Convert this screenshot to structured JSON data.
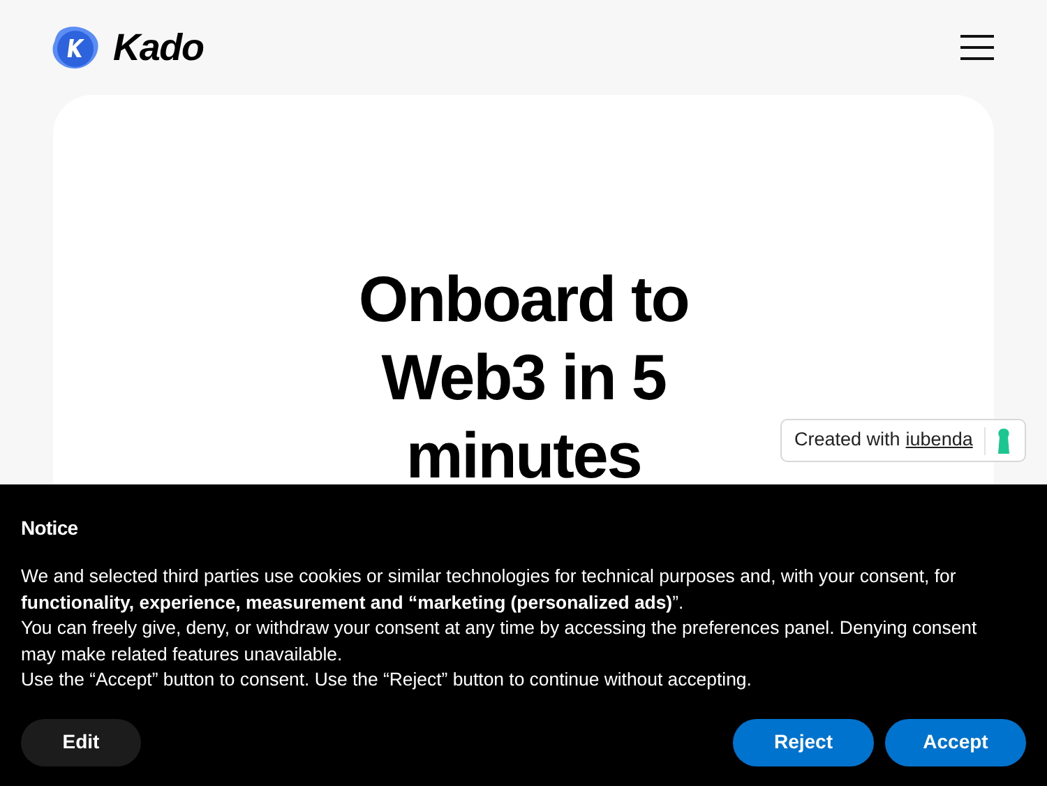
{
  "header": {
    "logo_text": "Kado"
  },
  "hero": {
    "headline": "Onboard to Web3 in 5 minutes"
  },
  "badge": {
    "prefix": "Created with",
    "link": "iubenda"
  },
  "notice": {
    "title": "Notice",
    "paragraphs": [
      "We and selected third parties use cookies or similar technologies for technical purposes and, with your consent, for **functionality, experience, measurement and “marketing (personalized ads)**”.",
      "You can freely give, deny, or withdraw your consent at any time by accessing the preferences panel. Denying consent may make related features unavailable.",
      "Use the “Accept” button to consent. Use the “Reject” button to continue without accepting."
    ],
    "buttons": [
      {
        "label": "Edit",
        "kind": "secondary"
      },
      {
        "label": "Reject",
        "kind": "primary"
      },
      {
        "label": "Accept",
        "kind": "primary"
      }
    ]
  }
}
